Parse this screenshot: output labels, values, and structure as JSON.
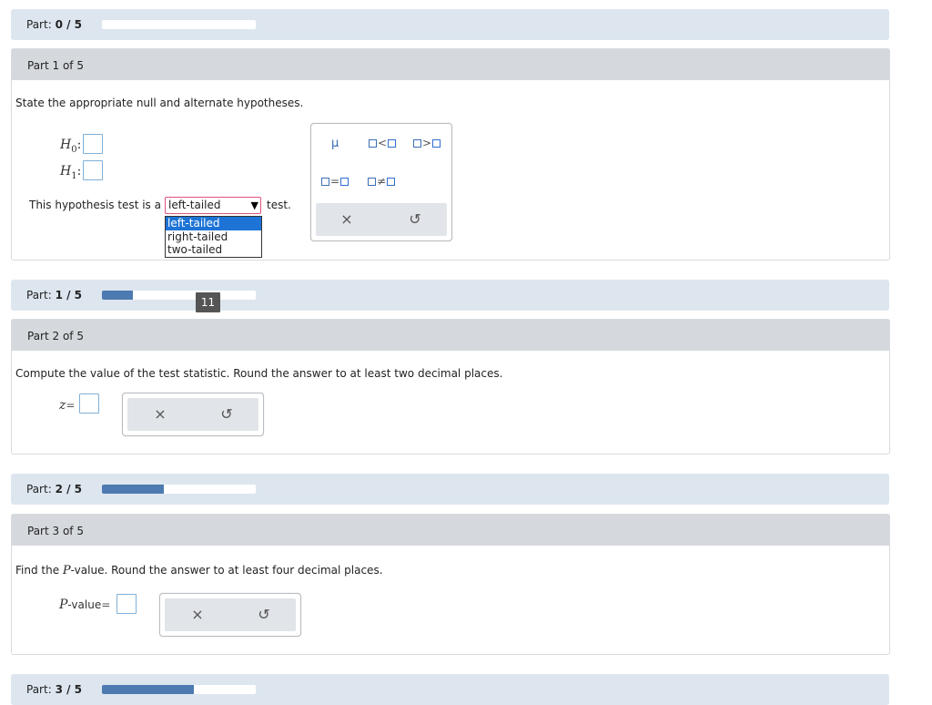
{
  "progress": [
    {
      "label": "Part:",
      "value": "0 / 5",
      "fraction": 0.0
    },
    {
      "label": "Part:",
      "value": "1 / 5",
      "fraction": 0.2
    },
    {
      "label": "Part:",
      "value": "2 / 5",
      "fraction": 0.4
    },
    {
      "label": "Part:",
      "value": "3 / 5",
      "fraction": 0.6
    }
  ],
  "part1": {
    "header": "Part 1 of 5",
    "prompt": "State the appropriate null and alternate hypotheses.",
    "h0_label": "H",
    "h0_sub": "0",
    "h1_label": "H",
    "h1_sub": "1",
    "test_prefix": "This hypothesis test is a",
    "test_suffix": "test.",
    "select_value": "left-tailed",
    "select_options": [
      "left-tailed",
      "right-tailed",
      "two-tailed"
    ],
    "palette": {
      "mu": "μ",
      "lt": "<",
      "gt": ">",
      "eq": "=",
      "ne": "≠",
      "clear": "×",
      "undo": "↺"
    }
  },
  "tooltip": "11",
  "part2": {
    "header": "Part 2 of 5",
    "prompt": "Compute the value of the test statistic. Round the answer to at least two decimal places.",
    "z_label": "z",
    "eq": "=",
    "clear": "×",
    "undo": "↺"
  },
  "part3": {
    "header": "Part 3 of 5",
    "prompt_pre": "Find the ",
    "prompt_var": "P",
    "prompt_post": "-value. Round the answer to at least four decimal places.",
    "p_label": "P",
    "p_suffix": "-value",
    "eq": "=",
    "clear": "×",
    "undo": "↺"
  }
}
